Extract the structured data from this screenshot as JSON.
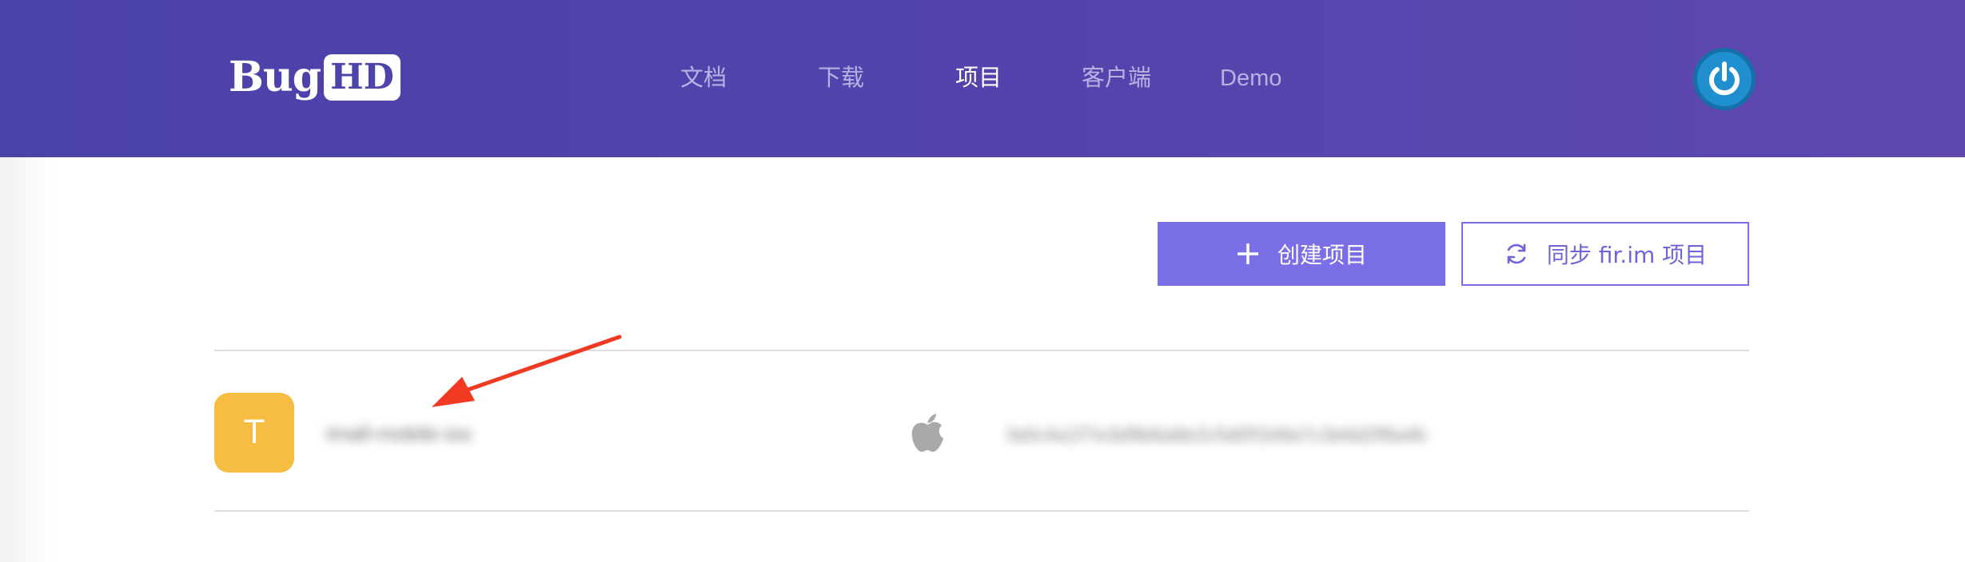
{
  "header": {
    "logo": {
      "bug": "Bug",
      "hd": "HD"
    },
    "nav": [
      {
        "label": "文档",
        "active": false
      },
      {
        "label": "下载",
        "active": false
      },
      {
        "label": "项目",
        "active": true
      },
      {
        "label": "客户端",
        "active": false
      },
      {
        "label": "Demo",
        "active": false
      }
    ],
    "user_icon": "power-icon"
  },
  "actions": {
    "create_label": "创建项目",
    "create_icon": "plus-icon",
    "sync_label": "同步 fir.im 项目",
    "sync_icon": "sync-icon"
  },
  "projects": [
    {
      "avatar_letter": "T",
      "avatar_color": "#f5bd41",
      "name": "tmall-mobile-ios",
      "platform": "apple-icon",
      "key": "fa0c4a1f7e3d9b6a8e2c5d0f1b9a7c3e6d2f8a4b"
    }
  ],
  "colors": {
    "header_start": "#4a41a9",
    "header_end": "#5e48ae",
    "accent": "#7a6fe6",
    "annotation_arrow": "#f03a22"
  }
}
